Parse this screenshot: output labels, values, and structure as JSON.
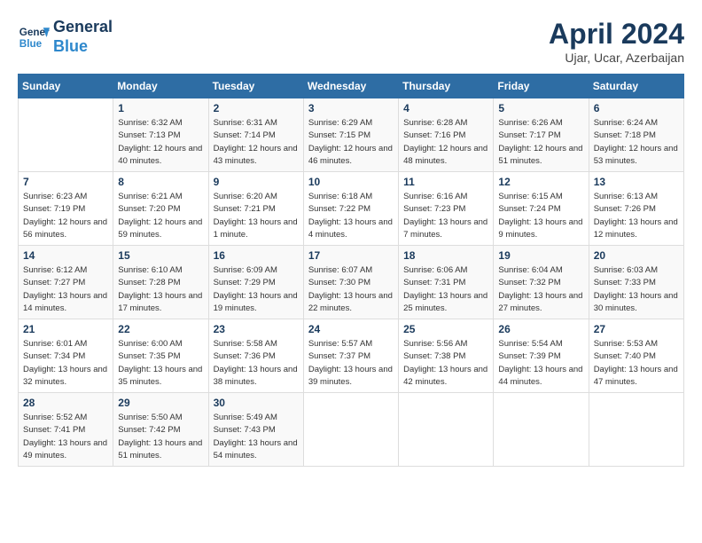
{
  "header": {
    "logo_line1": "General",
    "logo_line2": "Blue",
    "month": "April 2024",
    "location": "Ujar, Ucar, Azerbaijan"
  },
  "weekdays": [
    "Sunday",
    "Monday",
    "Tuesday",
    "Wednesday",
    "Thursday",
    "Friday",
    "Saturday"
  ],
  "weeks": [
    [
      {
        "day": null
      },
      {
        "day": "1",
        "sunrise": "6:32 AM",
        "sunset": "7:13 PM",
        "daylight": "12 hours and 40 minutes."
      },
      {
        "day": "2",
        "sunrise": "6:31 AM",
        "sunset": "7:14 PM",
        "daylight": "12 hours and 43 minutes."
      },
      {
        "day": "3",
        "sunrise": "6:29 AM",
        "sunset": "7:15 PM",
        "daylight": "12 hours and 46 minutes."
      },
      {
        "day": "4",
        "sunrise": "6:28 AM",
        "sunset": "7:16 PM",
        "daylight": "12 hours and 48 minutes."
      },
      {
        "day": "5",
        "sunrise": "6:26 AM",
        "sunset": "7:17 PM",
        "daylight": "12 hours and 51 minutes."
      },
      {
        "day": "6",
        "sunrise": "6:24 AM",
        "sunset": "7:18 PM",
        "daylight": "12 hours and 53 minutes."
      }
    ],
    [
      {
        "day": "7",
        "sunrise": "6:23 AM",
        "sunset": "7:19 PM",
        "daylight": "12 hours and 56 minutes."
      },
      {
        "day": "8",
        "sunrise": "6:21 AM",
        "sunset": "7:20 PM",
        "daylight": "12 hours and 59 minutes."
      },
      {
        "day": "9",
        "sunrise": "6:20 AM",
        "sunset": "7:21 PM",
        "daylight": "13 hours and 1 minute."
      },
      {
        "day": "10",
        "sunrise": "6:18 AM",
        "sunset": "7:22 PM",
        "daylight": "13 hours and 4 minutes."
      },
      {
        "day": "11",
        "sunrise": "6:16 AM",
        "sunset": "7:23 PM",
        "daylight": "13 hours and 7 minutes."
      },
      {
        "day": "12",
        "sunrise": "6:15 AM",
        "sunset": "7:24 PM",
        "daylight": "13 hours and 9 minutes."
      },
      {
        "day": "13",
        "sunrise": "6:13 AM",
        "sunset": "7:26 PM",
        "daylight": "13 hours and 12 minutes."
      }
    ],
    [
      {
        "day": "14",
        "sunrise": "6:12 AM",
        "sunset": "7:27 PM",
        "daylight": "13 hours and 14 minutes."
      },
      {
        "day": "15",
        "sunrise": "6:10 AM",
        "sunset": "7:28 PM",
        "daylight": "13 hours and 17 minutes."
      },
      {
        "day": "16",
        "sunrise": "6:09 AM",
        "sunset": "7:29 PM",
        "daylight": "13 hours and 19 minutes."
      },
      {
        "day": "17",
        "sunrise": "6:07 AM",
        "sunset": "7:30 PM",
        "daylight": "13 hours and 22 minutes."
      },
      {
        "day": "18",
        "sunrise": "6:06 AM",
        "sunset": "7:31 PM",
        "daylight": "13 hours and 25 minutes."
      },
      {
        "day": "19",
        "sunrise": "6:04 AM",
        "sunset": "7:32 PM",
        "daylight": "13 hours and 27 minutes."
      },
      {
        "day": "20",
        "sunrise": "6:03 AM",
        "sunset": "7:33 PM",
        "daylight": "13 hours and 30 minutes."
      }
    ],
    [
      {
        "day": "21",
        "sunrise": "6:01 AM",
        "sunset": "7:34 PM",
        "daylight": "13 hours and 32 minutes."
      },
      {
        "day": "22",
        "sunrise": "6:00 AM",
        "sunset": "7:35 PM",
        "daylight": "13 hours and 35 minutes."
      },
      {
        "day": "23",
        "sunrise": "5:58 AM",
        "sunset": "7:36 PM",
        "daylight": "13 hours and 38 minutes."
      },
      {
        "day": "24",
        "sunrise": "5:57 AM",
        "sunset": "7:37 PM",
        "daylight": "13 hours and 39 minutes."
      },
      {
        "day": "25",
        "sunrise": "5:56 AM",
        "sunset": "7:38 PM",
        "daylight": "13 hours and 42 minutes."
      },
      {
        "day": "26",
        "sunrise": "5:54 AM",
        "sunset": "7:39 PM",
        "daylight": "13 hours and 44 minutes."
      },
      {
        "day": "27",
        "sunrise": "5:53 AM",
        "sunset": "7:40 PM",
        "daylight": "13 hours and 47 minutes."
      }
    ],
    [
      {
        "day": "28",
        "sunrise": "5:52 AM",
        "sunset": "7:41 PM",
        "daylight": "13 hours and 49 minutes."
      },
      {
        "day": "29",
        "sunrise": "5:50 AM",
        "sunset": "7:42 PM",
        "daylight": "13 hours and 51 minutes."
      },
      {
        "day": "30",
        "sunrise": "5:49 AM",
        "sunset": "7:43 PM",
        "daylight": "13 hours and 54 minutes."
      },
      {
        "day": null
      },
      {
        "day": null
      },
      {
        "day": null
      },
      {
        "day": null
      }
    ]
  ]
}
